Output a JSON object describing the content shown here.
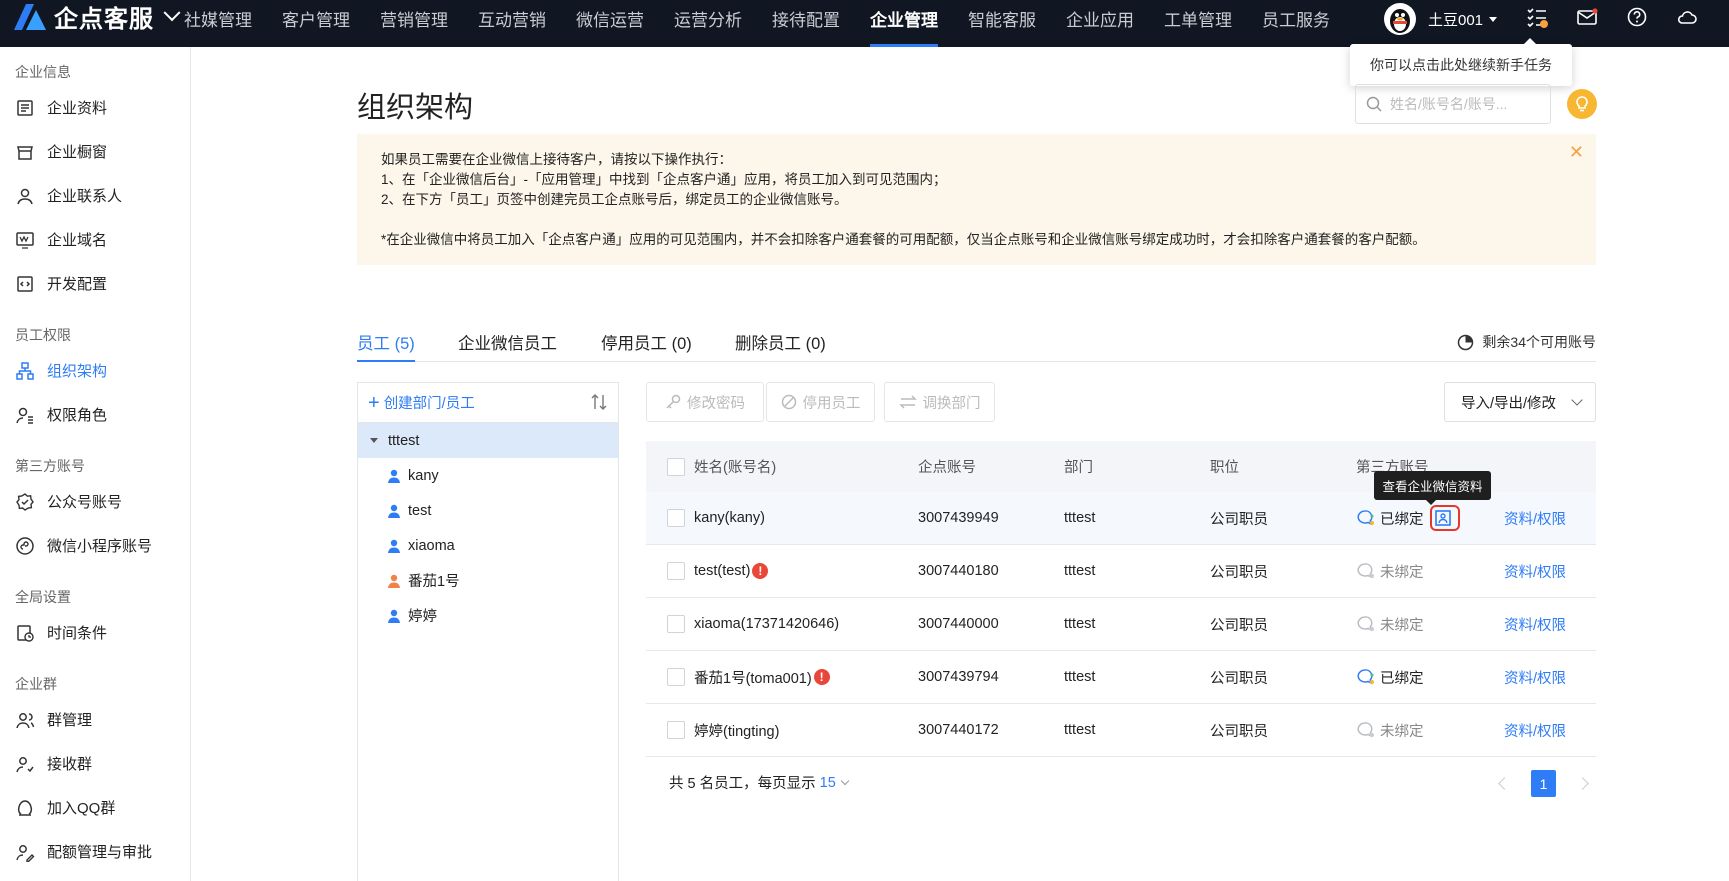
{
  "app": {
    "name": "企点客服"
  },
  "nav": {
    "items": [
      "社媒管理",
      "客户管理",
      "营销管理",
      "互动营销",
      "微信运营",
      "运营分析",
      "接待配置",
      "企业管理",
      "智能客服",
      "企业应用",
      "工单管理",
      "员工服务"
    ],
    "active_index": 7
  },
  "user": {
    "name": "土豆001"
  },
  "tip": "你可以点击此处继续新手任务",
  "sidebar": {
    "groups": [
      {
        "title": "企业信息",
        "items": [
          "企业资料",
          "企业橱窗",
          "企业联系人",
          "企业域名",
          "开发配置"
        ]
      },
      {
        "title": "员工权限",
        "items": [
          "组织架构",
          "权限角色"
        ]
      },
      {
        "title": "第三方账号",
        "items": [
          "公众号账号",
          "微信小程序账号"
        ]
      },
      {
        "title": "全局设置",
        "items": [
          "时间条件"
        ]
      },
      {
        "title": "企业群",
        "items": [
          "群管理",
          "接收群",
          "加入QQ群",
          "配额管理与审批"
        ]
      }
    ],
    "active_item": "组织架构"
  },
  "page": {
    "title": "组织架构",
    "search_placeholder": "姓名/账号名/账号..."
  },
  "notice": {
    "lines": [
      "如果员工需要在企业微信上接待客户，请按以下操作执行：",
      "1、在「企业微信后台」-「应用管理」中找到「企点客户通」应用，将员工加入到可见范围内；",
      "2、在下方「员工」页签中创建完员工企点账号后，绑定员工的企业微信账号。"
    ],
    "footnote": "*在企业微信中将员工加入「企点客户通」应用的可见范围内，并不会扣除客户通套餐的可用配额，仅当企点账号和企业微信账号绑定成功时，才会扣除客户通套餐的客户配额。"
  },
  "tabs": [
    "员工 (5)",
    "企业微信员工",
    "停用员工 (0)",
    "删除员工 (0)"
  ],
  "remaining": "剩余34个可用账号",
  "tree": {
    "create_label": "创建部门/员工",
    "root": "tttest",
    "members": [
      {
        "name": "kany",
        "color": "#2e7cf6"
      },
      {
        "name": "test",
        "color": "#2e7cf6"
      },
      {
        "name": "xiaoma",
        "color": "#2e7cf6"
      },
      {
        "name": "番茄1号",
        "color": "#f0824a"
      },
      {
        "name": "婷婷",
        "color": "#2e7cf6"
      }
    ]
  },
  "toolbar": {
    "change_password": "修改密码",
    "disable_staff": "停用员工",
    "move_dept": "调换部门",
    "export": "导入/导出/修改"
  },
  "table": {
    "headers": [
      "姓名(账号名)",
      "企点账号",
      "部门",
      "职位",
      "第三方账号"
    ],
    "rows": [
      {
        "name": "kany(kany)",
        "warn": false,
        "account": "3007439949",
        "dept": "tttest",
        "role": "公司职员",
        "bind": "已绑定",
        "bound": true,
        "action": "资料/权限"
      },
      {
        "name": "test(test)",
        "warn": true,
        "account": "3007440180",
        "dept": "tttest",
        "role": "公司职员",
        "bind": "未绑定",
        "bound": false,
        "action": "资料/权限"
      },
      {
        "name": "xiaoma(17371420646)",
        "warn": false,
        "account": "3007440000",
        "dept": "tttest",
        "role": "公司职员",
        "bind": "未绑定",
        "bound": false,
        "action": "资料/权限"
      },
      {
        "name": "番茄1号(toma001)",
        "warn": true,
        "account": "3007439794",
        "dept": "tttest",
        "role": "公司职员",
        "bind": "已绑定",
        "bound": true,
        "action": "资料/权限"
      },
      {
        "name": "婷婷(tingting)",
        "warn": false,
        "account": "3007440172",
        "dept": "tttest",
        "role": "公司职员",
        "bind": "未绑定",
        "bound": false,
        "action": "资料/权限"
      }
    ],
    "tooltip": "查看企业微信资料"
  },
  "footer": {
    "summary": "共 5 名员工，每页显示",
    "page_size": "15",
    "current_page": "1"
  }
}
